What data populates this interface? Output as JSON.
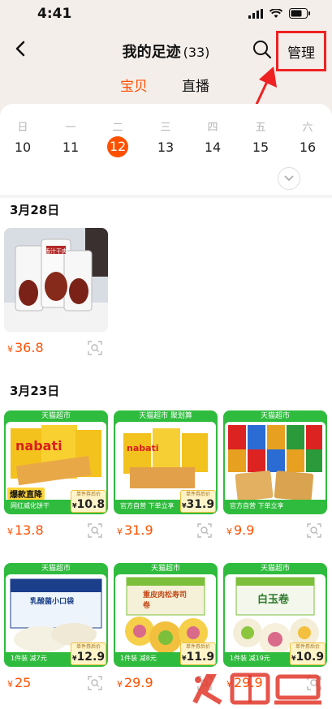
{
  "status": {
    "time": "4:41"
  },
  "nav": {
    "title": "我的足迹",
    "count": "(33)",
    "manage": "管理"
  },
  "tabs": [
    {
      "label": "宝贝"
    },
    {
      "label": "直播"
    }
  ],
  "week": [
    {
      "weekday": "日",
      "day": "10"
    },
    {
      "weekday": "一",
      "day": "11"
    },
    {
      "weekday": "二",
      "day": "12"
    },
    {
      "weekday": "三",
      "day": "13"
    },
    {
      "weekday": "四",
      "day": "14"
    },
    {
      "weekday": "五",
      "day": "15"
    },
    {
      "weekday": "六",
      "day": "16"
    }
  ],
  "selected_day": "12",
  "sections": [
    {
      "date": "3月28日"
    },
    {
      "date": "3月23日"
    }
  ],
  "products": [
    {
      "price": "36.8",
      "image_text": "香汁干肉",
      "tmall": false
    },
    {
      "price": "13.8",
      "tag": "天猫超市",
      "badge": "爆款直降",
      "strip": "网红威化饼干",
      "box_label": "单件券后价",
      "box_price": "10.8",
      "image_text": "nabati",
      "tmall": true
    },
    {
      "price": "31.9",
      "tag": "天猫超市 聚划算",
      "strip": "官方自营  下单立享",
      "box_label": "单件券后价",
      "box_price": "31.9",
      "image_text": "nabati",
      "tmall": true
    },
    {
      "price": "9.9",
      "tag": "天猫超市",
      "strip": "官方自营  下单立享",
      "image_text": "",
      "tmall": true
    },
    {
      "price": "25",
      "tag": "天猫超市",
      "strip": "1件装  减7元",
      "box_label": "单件券后价",
      "box_price": "12.9",
      "image_text": "乳酸菌小口袋",
      "tmall": true
    },
    {
      "price": "29.9",
      "tag": "天猫超市",
      "strip": "1件装  减8元",
      "box_label": "单件券后价",
      "box_price": "11.9",
      "image_text": "重皮肉松寿司卷",
      "tmall": true
    },
    {
      "price": "29.9",
      "tag": "天猫超市",
      "strip": "1件装  减19元",
      "box_label": "单件券后价",
      "box_price": "10.9",
      "image_text": "白玉卷",
      "tmall": true
    }
  ],
  "currency": "¥",
  "colors": {
    "accent": "#ff5000",
    "tmall_green": "#2fbc3e",
    "highlight_red": "#ee2222"
  }
}
